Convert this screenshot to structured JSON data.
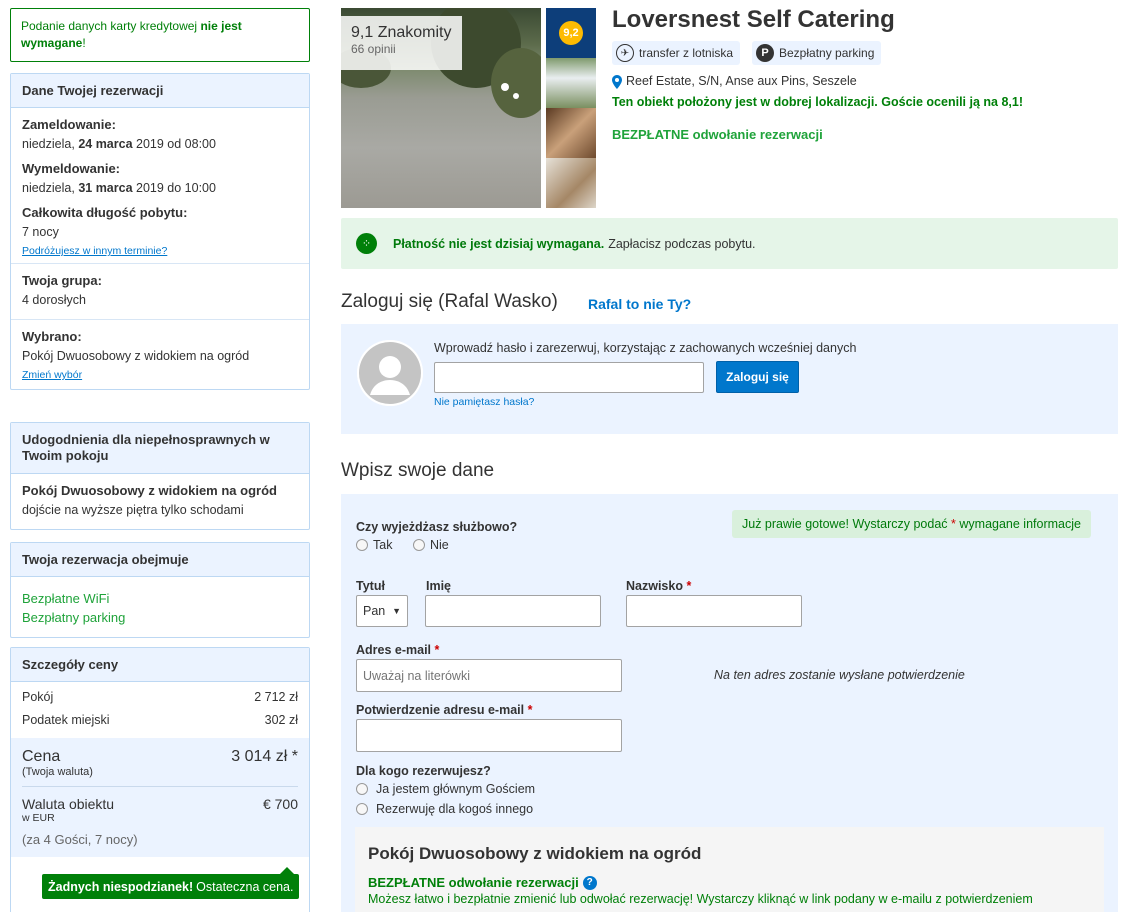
{
  "notice": {
    "text": "Podanie danych karty kredytowej",
    "bold": "nie jest wymagane",
    "end": "!"
  },
  "reservation": {
    "header": "Dane Twojej rezerwacji",
    "checkin_label": "Zameldowanie:",
    "checkin_day": "niedziela,",
    "checkin_date": "24 marca",
    "checkin_rest": "2019 od 08:00",
    "checkout_label": "Wymeldowanie:",
    "checkout_day": "niedziela,",
    "checkout_date": "31 marca",
    "checkout_rest": "2019 do 10:00",
    "length_label": "Całkowita długość pobytu:",
    "length_value": "7 nocy",
    "other_dates_link": "Podróżujesz w innym terminie?",
    "group_label": "Twoja grupa:",
    "group_value": "4 dorosłych",
    "selected_label": "Wybrano:",
    "selected_value": "Pokój Dwuosobowy z widokiem na ogród",
    "change_link": "Zmień wybór"
  },
  "accessibility": {
    "header": "Udogodnienia dla niepełnosprawnych w Twoim pokoju",
    "room": "Pokój Dwuosobowy z widokiem na ogród",
    "info": "dojście na wyższe piętra tylko schodami"
  },
  "includes": {
    "header": "Twoja rezerwacja obejmuje",
    "items": [
      "Bezpłatne WiFi",
      "Bezpłatny parking"
    ]
  },
  "price": {
    "header": "Szczegóły ceny",
    "room_label": "Pokój",
    "room_value": "2 712 zł",
    "tax_label": "Podatek miejski",
    "tax_value": "302 zł",
    "total_label": "Cena",
    "total_value": "3 014 zł *",
    "total_sub": "(Twoja waluta)",
    "property_label": "Waluta obiektu",
    "property_sub": "w EUR",
    "property_value": "€ 700",
    "guests": "(za 4 Gości, 7 nocy)",
    "tip_bold": "Żadnych niespodzianek!",
    "tip_text": "Ostateczna cena."
  },
  "hotel": {
    "name": "Loversnest Self Catering",
    "score": "9,1 Znakomity",
    "reviews": "66 opinii",
    "award_score": "9,2",
    "facility_1": "transfer z lotniska",
    "facility_2": "Bezpłatny parking",
    "address": "Reef Estate, S/N, Anse aux Pins, Seszele",
    "location_note": "Ten obiekt położony jest w dobrej lokalizacji. Goście ocenili ją na 8,1!",
    "free_cancel": "BEZPŁATNE odwołanie rezerwacji"
  },
  "payment": {
    "bold": "Płatność nie jest dzisiaj wymagana.",
    "text": "Zapłacisz podczas pobytu."
  },
  "login": {
    "title": "Zaloguj się (Rafal Wasko)",
    "not_you": "Rafal to nie Ty?",
    "hint": "Wprowadź hasło i zarezerwuj, korzystając z zachowanych wcześniej danych",
    "button": "Zaloguj się",
    "forgot": "Nie pamiętasz hasła?"
  },
  "form": {
    "title": "Wpisz swoje dane",
    "business_label": "Czy wyjeżdżasz służbowo?",
    "yes": "Tak",
    "no": "Nie",
    "almost_text": "Już prawie gotowe! Wystarczy podać",
    "almost_star": "*",
    "almost_end": "wymagane informacje",
    "title_label": "Tytuł",
    "title_value": "Pan",
    "first_name_label": "Imię",
    "last_name_label": "Nazwisko",
    "email_label": "Adres e-mail",
    "email_placeholder": "Uważaj na literówki",
    "email_note": "Na ten adres zostanie wysłane potwierdzenie",
    "email_confirm_label": "Potwierdzenie adresu e-mail",
    "for_whom_label": "Dla kogo rezerwujesz?",
    "for_me": "Ja jestem głównym Gościem",
    "for_other": "Rezerwuję dla kogoś innego",
    "required_star": "*"
  },
  "room": {
    "title": "Pokój Dwuosobowy z widokiem na ogród",
    "free_cancel": "BEZPŁATNE odwołanie rezerwacji",
    "desc": "Możesz łatwo i bezpłatnie zmienić lub odwołać rezerwację! Wystarczy kliknąć w link podany w e-mailu z potwierdzeniem"
  }
}
